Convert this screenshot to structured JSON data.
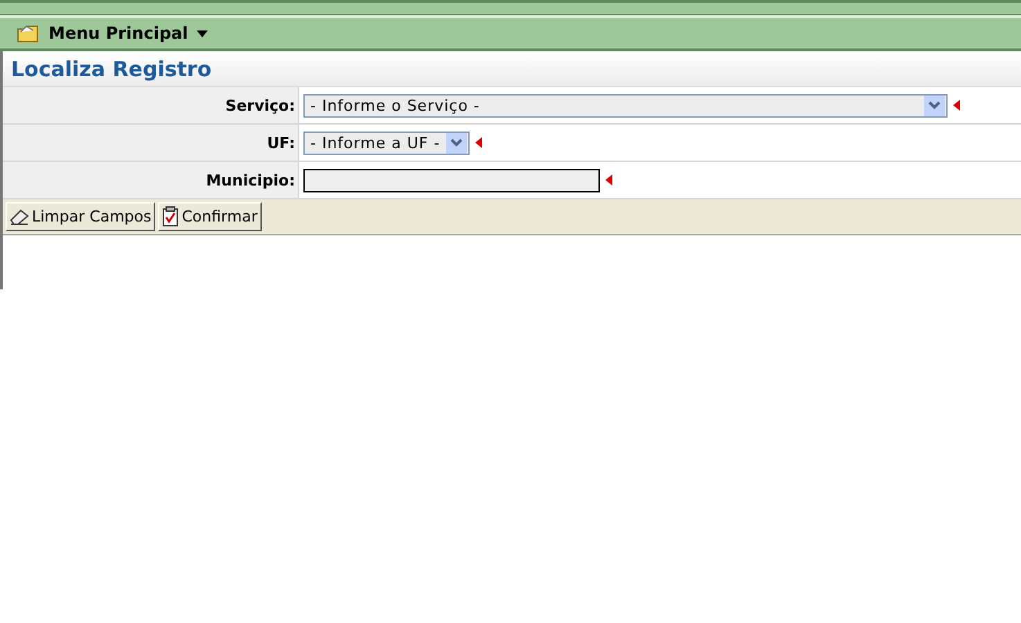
{
  "menu": {
    "label": "Menu Principal"
  },
  "title": "Localiza Registro",
  "fields": [
    {
      "label": "Serviço:",
      "kind": "select",
      "value": "- Informe o Serviço -",
      "required": true
    },
    {
      "label": "UF:",
      "kind": "select",
      "value": "- Informe a UF -",
      "required": true
    },
    {
      "label": "Municipio:",
      "kind": "text",
      "required": true
    }
  ],
  "buttons": [
    {
      "label": "Limpar Campos",
      "kind": "eraser"
    },
    {
      "label": "Confirmar",
      "kind": "clipboard"
    }
  ]
}
